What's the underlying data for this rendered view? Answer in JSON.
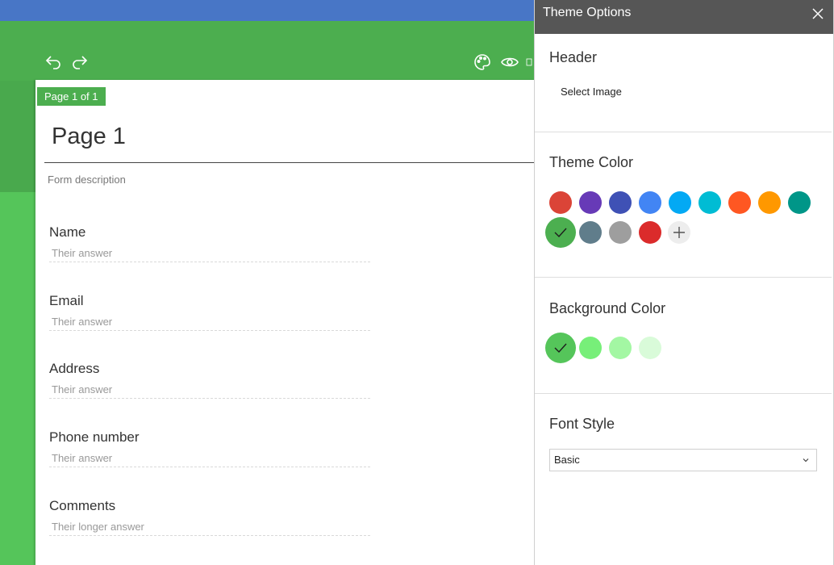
{
  "toolbar": {
    "undo_icon": "undo-icon",
    "redo_icon": "redo-icon",
    "palette_icon": "palette-icon",
    "preview_icon": "eye-icon"
  },
  "form": {
    "page_badge": "Page 1 of 1",
    "title": "Page 1",
    "description": "Form description",
    "fields": [
      {
        "label": "Name",
        "placeholder": "Their answer"
      },
      {
        "label": "Email",
        "placeholder": "Their answer"
      },
      {
        "label": "Address",
        "placeholder": "Their answer"
      },
      {
        "label": "Phone number",
        "placeholder": "Their answer"
      },
      {
        "label": "Comments",
        "placeholder": "Their longer answer"
      }
    ]
  },
  "panel": {
    "title": "Theme Options",
    "header": {
      "title": "Header",
      "select_image": "Select Image"
    },
    "theme_color": {
      "title": "Theme Color",
      "colors": [
        "#db4437",
        "#673ab7",
        "#3f51b5",
        "#4285f4",
        "#03a9f4",
        "#00bcd4",
        "#ff5722",
        "#ff9800",
        "#009688",
        "#4caf50",
        "#607d8b",
        "#9e9e9e",
        "#db2b2b"
      ],
      "selected": "#4caf50"
    },
    "background_color": {
      "title": "Background Color",
      "colors": [
        "#55c55a",
        "#77ef79",
        "#a3f7a3",
        "#d9fbd9"
      ],
      "selected": "#55c55a"
    },
    "font_style": {
      "title": "Font Style",
      "value": "Basic"
    }
  },
  "colors": {
    "toolbar": "#4cae4f",
    "top_strip": "#4876c6",
    "panel_header": "#565656"
  }
}
